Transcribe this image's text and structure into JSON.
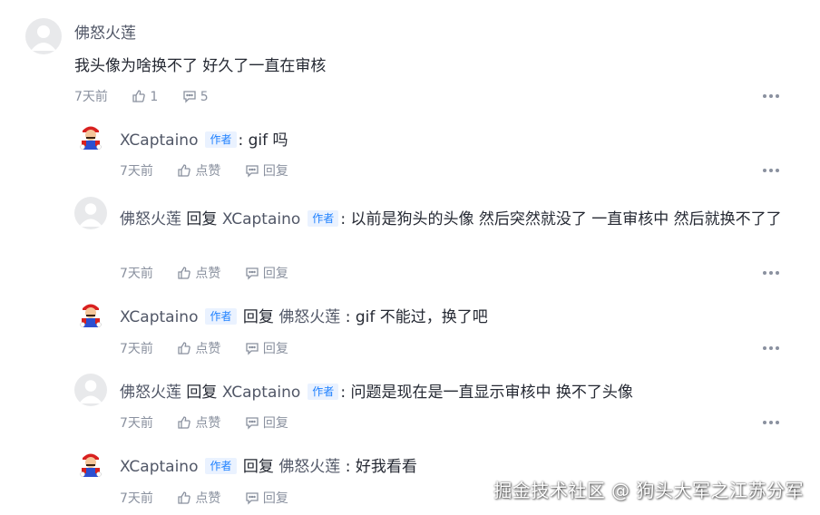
{
  "main_comment": {
    "author": "佛怒火莲",
    "text": "我头像为啥换不了 好久了一直在审核",
    "time": "7天前",
    "likes": "1",
    "replies_count": "5"
  },
  "replies": [
    {
      "author": "XCaptaino",
      "badge": "作者",
      "reply_word": "",
      "target": "",
      "text": ": gif 吗",
      "time": "7天前",
      "like_label": "点赞",
      "reply_label": "回复",
      "avatar": "mario"
    },
    {
      "author": "佛怒火莲",
      "badge": "",
      "reply_word": "回复",
      "target": "XCaptaino",
      "target_badge": "作者",
      "text": ": 以前是狗头的头像 然后突然就没了 一直审核中 然后就换不了了",
      "time": "7天前",
      "like_label": "点赞",
      "reply_label": "回复",
      "avatar": "default"
    },
    {
      "author": "XCaptaino",
      "badge": "作者",
      "reply_word": "回复",
      "target": "佛怒火莲",
      "text": ": gif 不能过，换了吧",
      "time": "7天前",
      "like_label": "点赞",
      "reply_label": "回复",
      "avatar": "mario"
    },
    {
      "author": "佛怒火莲",
      "badge": "",
      "reply_word": "回复",
      "target": "XCaptaino",
      "target_badge": "作者",
      "text": ": 问题是现在是一直显示审核中 换不了头像",
      "time": "7天前",
      "like_label": "点赞",
      "reply_label": "回复",
      "avatar": "default"
    },
    {
      "author": "XCaptaino",
      "badge": "作者",
      "reply_word": "回复",
      "target": "佛怒火莲",
      "text": ": 好我看看",
      "time": "7天前",
      "like_label": "点赞",
      "reply_label": "回复",
      "avatar": "mario"
    }
  ],
  "watermark": "掘金技术社区 @ 狗头大军之江苏分军",
  "colors": {
    "badge_text": "#1e80ff",
    "badge_bg": "#eaf2ff",
    "muted": "#8a919f",
    "text": "#252933"
  }
}
